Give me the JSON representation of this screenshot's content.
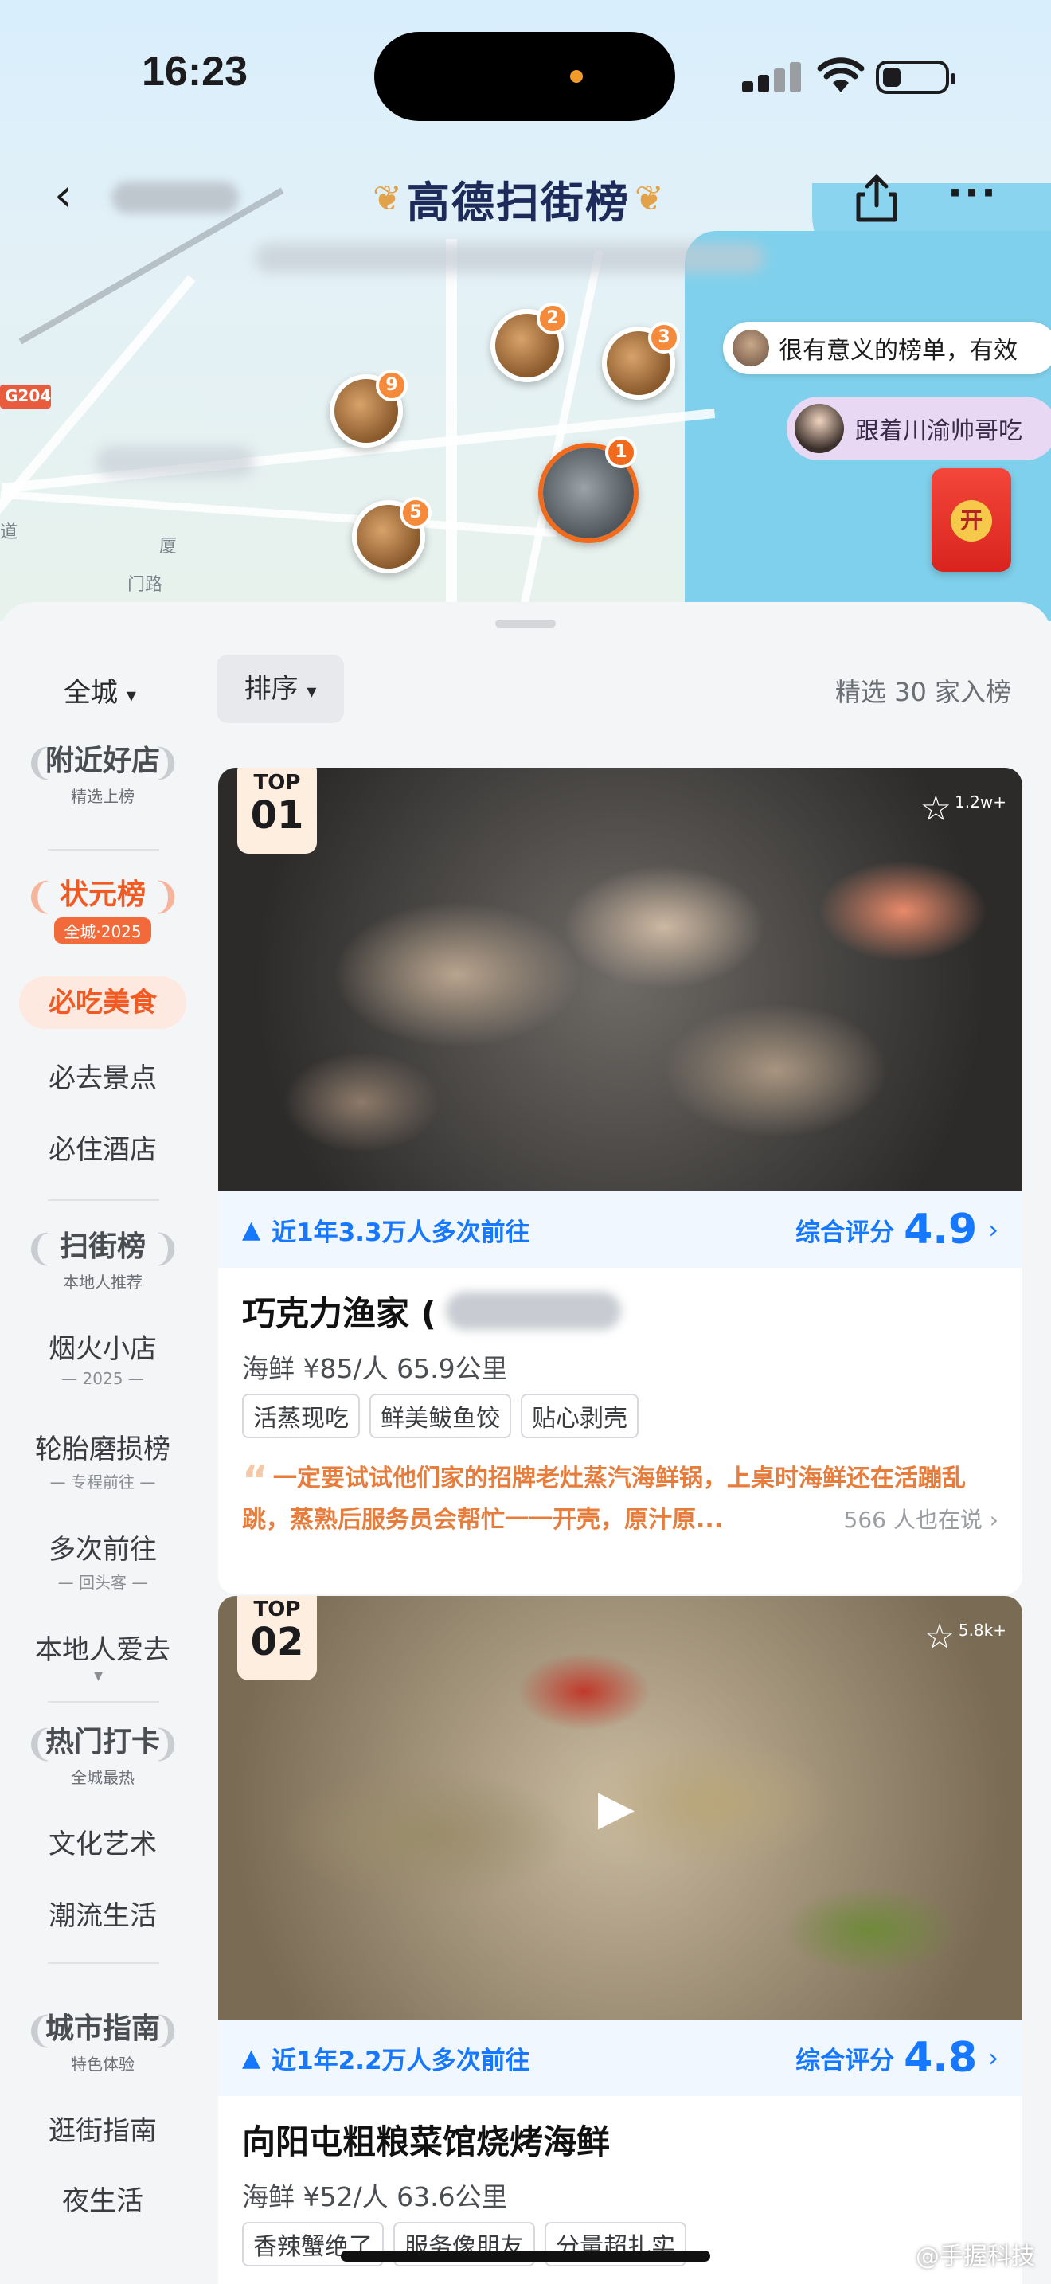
{
  "status_bar": {
    "time": "16:23"
  },
  "header": {
    "back_glyph": "‹",
    "laurel_left": "❦",
    "title": "高德扫街榜",
    "laurel_right": "❦",
    "more_glyph": "···"
  },
  "map": {
    "road_label": "G204",
    "label_lower_left": "道",
    "label_lower": "厦",
    "label_lower2": "门路",
    "pins": [
      {
        "rank": "9"
      },
      {
        "rank": "2"
      },
      {
        "rank": "3"
      },
      {
        "rank": "1"
      },
      {
        "rank": "5"
      }
    ],
    "bubble_comment": "很有意义的榜单，有效",
    "bubble_follow": "跟着川渝帅哥吃",
    "redpack_label": "开"
  },
  "filters": {
    "city": "全城",
    "city_caret": "▾",
    "sort": "排序",
    "sort_caret": "▾",
    "count": "精选 30 家入榜"
  },
  "sidebar": {
    "nearby": {
      "main": "附近好店",
      "sub": "精选上榜"
    },
    "champion": {
      "main": "状元榜",
      "sub": "全城·2025"
    },
    "must_eat": "必吃美食",
    "must_see": "必去景点",
    "must_stay": "必住酒店",
    "street": {
      "main": "扫街榜",
      "sub": "本地人推荐"
    },
    "small_shops": {
      "label": "烟火小店",
      "sub": "— 2025 —"
    },
    "tire_wear": {
      "label": "轮胎磨损榜",
      "sub": "— 专程前往 —"
    },
    "repeat": {
      "label": "多次前往",
      "sub": "— 回头客 —"
    },
    "locals": "本地人爱去",
    "more_glyph": "▾",
    "hot": {
      "main": "热门打卡",
      "sub": "全城最热"
    },
    "culture": "文化艺术",
    "trend": "潮流生活",
    "guide": {
      "main": "城市指南",
      "sub": "特色体验"
    },
    "stroll": "逛街指南",
    "night": "夜生活"
  },
  "cards": [
    {
      "top_label": "TOP",
      "top_num": "01",
      "fav_count": "1.2w+",
      "visits": "近1年3.3万人多次前往",
      "rating_label": "综合评分",
      "rating": "4.9",
      "name": "巧克力渔家 (",
      "meta": "海鲜 ¥85/人 65.9公里",
      "tags": [
        "活蒸现吃",
        "鲜美鲅鱼饺",
        "贴心剥壳"
      ],
      "quote": "一定要试试他们家的招牌老灶蒸汽海鲜锅，上桌时海鲜还在活蹦乱跳，蒸熟后服务员会帮忙一一开壳，原汁原...",
      "talking": "566 人也在说 ›"
    },
    {
      "top_label": "TOP",
      "top_num": "02",
      "fav_count": "5.8k+",
      "visits": "近1年2.2万人多次前往",
      "rating_label": "综合评分",
      "rating": "4.8",
      "name": "向阳屯粗粮菜馆烧烤海鲜",
      "meta": "海鲜 ¥52/人 63.6公里",
      "tags": [
        "香辣蟹绝了",
        "服务像朋友",
        "分量超扎实"
      ]
    }
  ],
  "watermark": "@手握科技",
  "icons": {
    "back": "chevron-left-icon",
    "share": "share-icon",
    "more": "more-icon",
    "star": "star-icon",
    "play": "play-icon",
    "arrow": "navigation-arrow-icon"
  }
}
